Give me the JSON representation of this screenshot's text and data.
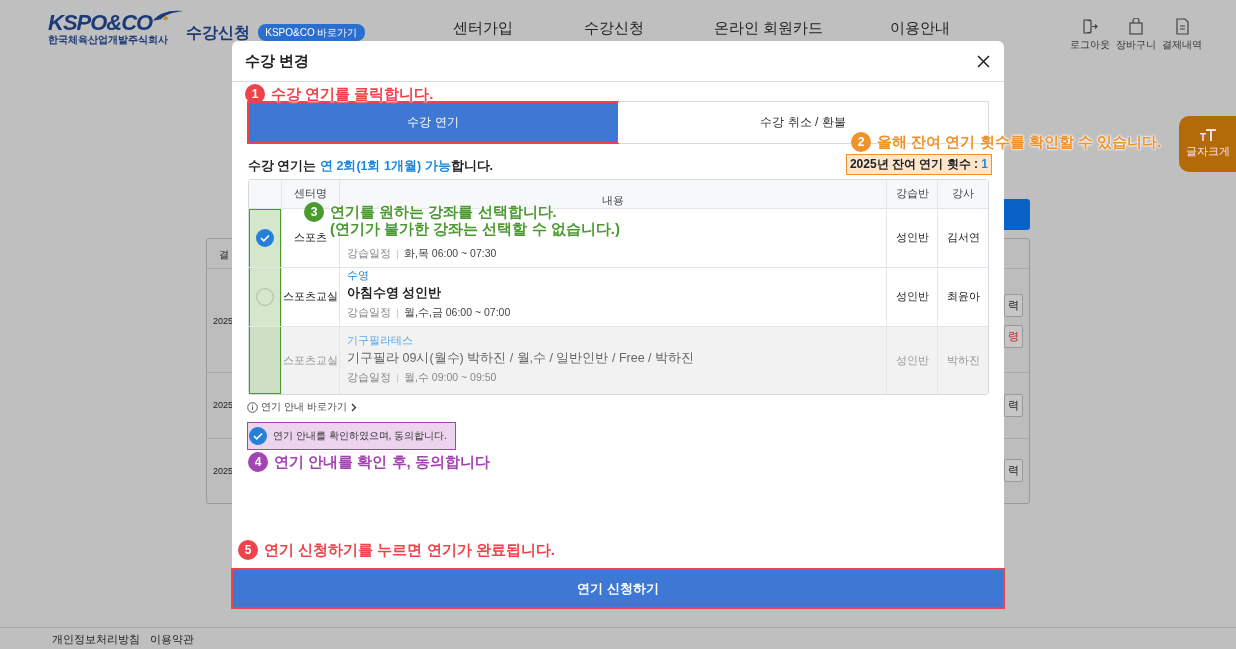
{
  "header": {
    "logo_text": "KSPO&CO",
    "logo_subtitle": "한국체육산업개발주식회사",
    "site_title": "수강신청",
    "shortcut_badge": "KSPO&CO 바로가기",
    "nav": [
      "센터가입",
      "수강신청",
      "온라인 회원카드",
      "이용안내"
    ],
    "utility": [
      {
        "kind": "logout",
        "label": "로그아웃"
      },
      {
        "kind": "cart",
        "label": "장바구니"
      },
      {
        "kind": "receipt",
        "label": "결제내역"
      }
    ],
    "font_size_button": "글자크게"
  },
  "background_list": {
    "header_fragment": "결",
    "rows": [
      {
        "date_fragment": "2025",
        "actions": [
          "력",
          "령"
        ]
      },
      {
        "date_fragment": "2025",
        "actions": [
          "력"
        ]
      },
      {
        "date_fragment": "2025",
        "actions": [
          "력"
        ]
      }
    ]
  },
  "modal": {
    "title": "수강 변경",
    "tabs": [
      {
        "label": "수강 연기",
        "selected": true
      },
      {
        "label": "수강 취소 / 환불",
        "selected": false
      }
    ],
    "notice": "수강 연기는 **연 2회(1회 1개월) 가능**합니다.",
    "remaining": {
      "label": "2025년 잔여 연기 횟수 :",
      "value": "1"
    },
    "table": {
      "columns": [
        "센터명",
        "내용",
        "강습반",
        "강사"
      ],
      "rows": [
        {
          "checked": true,
          "disabled": false,
          "center": "스포츠",
          "schedule_label": "강습일정",
          "schedule": "화,목 06:00 ~ 07:30",
          "class": "성인반",
          "instructor": "김서연"
        },
        {
          "checked": false,
          "disabled": false,
          "center": "스포츠교실",
          "category": "수영",
          "title": "아침수영 성인반",
          "schedule_label": "강습일정",
          "schedule": "월,수,금 06:00 ~ 07:00",
          "class": "성인반",
          "instructor": "최윤아"
        },
        {
          "checked": false,
          "disabled": true,
          "center": "스포츠교실",
          "category": "기구필라테스",
          "title": "기구필라 09시(월수) 박하진 / 월,수 / 일반인반 / Free / 박하진",
          "schedule_label": "강습일정",
          "schedule": "월,수 09:00 ~ 09:50",
          "class": "성인반",
          "instructor": "박하진"
        }
      ]
    },
    "guide_link": "연기 안내 바로가기",
    "agree": {
      "label": "연기 안내를 확인하였으며, 동의합니다.",
      "checked": true
    },
    "submit": "연기 신청하기"
  },
  "annotations": [
    {
      "number": "1",
      "lines": [
        "수강 연기를 클릭합니다."
      ],
      "color": "#f0424a"
    },
    {
      "number": "2",
      "lines": [
        "올해 잔여 연기 횟수를 확인할 수 있습니다."
      ],
      "color": "#f0922a"
    },
    {
      "number": "3",
      "lines": [
        "연기를 원하는 강좌를 선택합니다.",
        "(연기가 불가한 강좌는 선택할 수 없습니다.)"
      ],
      "color": "#4a9a2e"
    },
    {
      "number": "4",
      "lines": [
        "연기 안내를 확인 후, 동의합니다"
      ],
      "color": "#a443b4"
    },
    {
      "number": "5",
      "lines": [
        "연기 신청하기를 누르면 연기가 완료됩니다."
      ],
      "color": "#f0424a"
    }
  ],
  "footer": [
    "개인정보처리방침",
    "이용약관"
  ]
}
